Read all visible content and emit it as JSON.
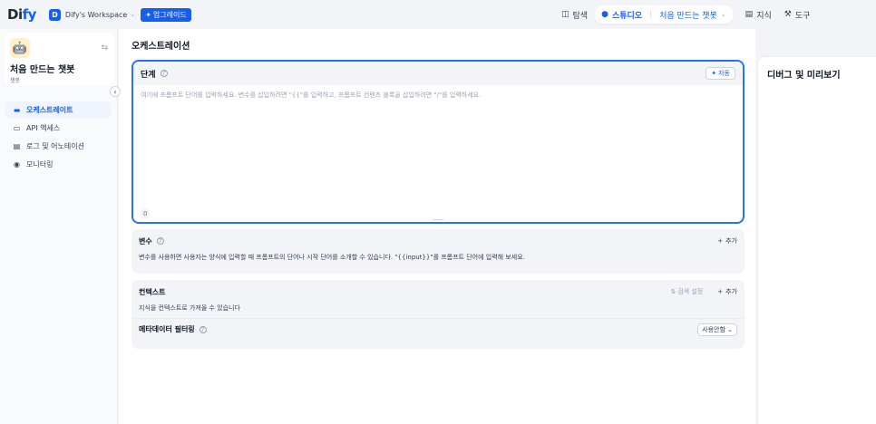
{
  "topbar": {
    "logo_text": "Di",
    "logo_accent": "fy",
    "workspace_initial": "D",
    "workspace_name": "Dify's Workspace",
    "upgrade_label": "업그레이드",
    "nav": {
      "explore": "탐색",
      "studio": "스튜디오",
      "current_app": "처음 만드는 챗봇",
      "knowledge": "지식",
      "tools": "도구"
    }
  },
  "sidebar": {
    "app_name": "처음 만드는 챗봇",
    "app_type": "챗봇",
    "items": [
      {
        "label": "오케스트레이트",
        "icon": "layout-icon",
        "active": true
      },
      {
        "label": "API 액세스",
        "icon": "terminal-icon"
      },
      {
        "label": "로그 및 어노테이션",
        "icon": "file-list-icon"
      },
      {
        "label": "모니터링",
        "icon": "dashboard-icon"
      }
    ]
  },
  "main": {
    "title": "오케스트레이션",
    "prompt": {
      "label": "단계",
      "auto_label": "자동",
      "placeholder": "여기에 프롬프트 단어를 입력하세요. 변수를 삽입하려면 \"{{\"를 입력하고, 프롬프트 컨텐츠 블록을 삽입하려면 \"/\"를 입력하세요.",
      "char_count": "0"
    },
    "variables": {
      "label": "변수",
      "add_label": "추가",
      "description": "변수를 사용하면 사용자는 양식에 입력할 때 프롬프트의 단어나 시작 단어를 소개할 수 있습니다. \"{{input}}\"를 프롬프트 단어에 입력해 보세요."
    },
    "context": {
      "label": "컨텍스트",
      "retrieval_label": "검색 설정",
      "add_label": "추가",
      "description": "지식을 컨텍스트로 가져올 수 있습니다",
      "metadata_label": "메타데이터 필터링",
      "metadata_value": "사용안함"
    }
  },
  "debug": {
    "title": "디버그 및 미리보기"
  },
  "colors": {
    "accent": "#155eef",
    "border_focus": "#2970ff"
  }
}
